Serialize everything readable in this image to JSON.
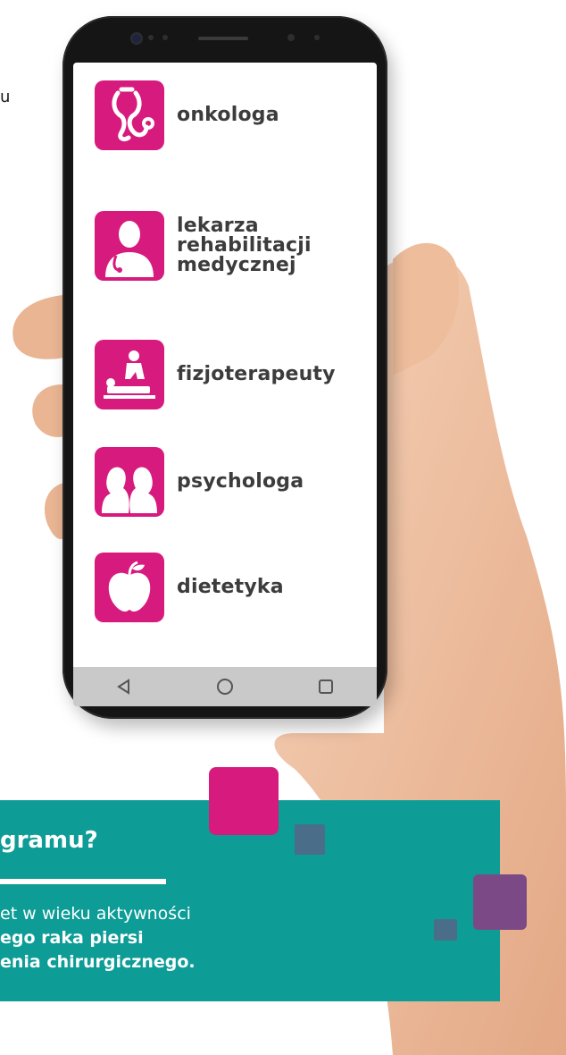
{
  "left_text_fragment": "u",
  "phone": {
    "items": [
      {
        "label_lines": [
          "onkologa"
        ],
        "icon": "stethoscope-icon"
      },
      {
        "label_lines": [
          "lekarza",
          "rehabilitacji",
          "medycznej"
        ],
        "icon": "doctor-icon"
      },
      {
        "label_lines": [
          "fizjoterapeuty"
        ],
        "icon": "physiotherapy-icon"
      },
      {
        "label_lines": [
          "psychologa"
        ],
        "icon": "two-heads-icon"
      },
      {
        "label_lines": [
          "dietetyka"
        ],
        "icon": "apple-icon"
      }
    ],
    "nav": [
      "back-icon",
      "home-icon",
      "recents-icon"
    ]
  },
  "band": {
    "title": "gramu?",
    "line1": "et w wieku aktywności",
    "line2": "ego raka piersi",
    "line3": "enia chirurgicznego."
  },
  "colors": {
    "accent": "#d71a7d",
    "teal": "#0d9c96",
    "purple": "#7b4a86",
    "slate": "#4a6e8a",
    "skin": "#f0c3a4"
  }
}
